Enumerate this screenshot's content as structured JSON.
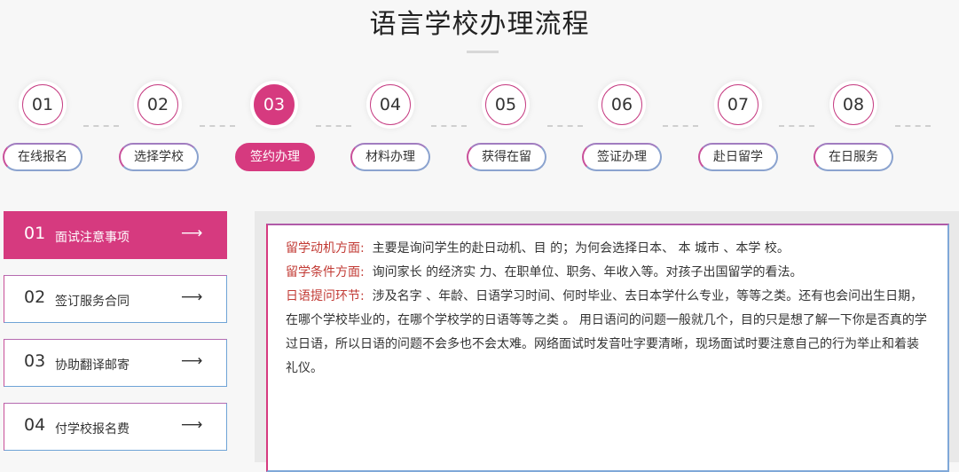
{
  "page": {
    "title": "语言学校办理流程"
  },
  "steps": [
    {
      "number": "01",
      "label": "在线报名",
      "active": false
    },
    {
      "number": "02",
      "label": "选择学校",
      "active": false
    },
    {
      "number": "03",
      "label": "签约办理",
      "active": true
    },
    {
      "number": "04",
      "label": "材料办理",
      "active": false
    },
    {
      "number": "05",
      "label": "获得在留",
      "active": false
    },
    {
      "number": "06",
      "label": "签证办理",
      "active": false
    },
    {
      "number": "07",
      "label": "赴日留学",
      "active": false
    },
    {
      "number": "08",
      "label": "在日服务",
      "active": false
    }
  ],
  "sidebar": {
    "items": [
      {
        "number": "01",
        "label": "面试注意事项",
        "arrow": "⟶",
        "active": true
      },
      {
        "number": "02",
        "label": "签订服务合同",
        "arrow": "⟶",
        "active": false
      },
      {
        "number": "03",
        "label": "协助翻译邮寄",
        "arrow": "⟶",
        "active": false
      },
      {
        "number": "04",
        "label": "付学校报名费",
        "arrow": "⟶",
        "active": false
      }
    ]
  },
  "content": {
    "paragraphs": [
      {
        "label": "留学动机方面:",
        "text": "主要是询问学生的赴日动机、目 的；为何会选择日本、 本 城市 、本学 校。"
      },
      {
        "label": "留学条件方面:",
        "text": "询问家长 的经济实 力、在职单位、职务、年收入等。对孩子出国留学的看法。"
      },
      {
        "label": "日语提问环节:",
        "text": "涉及名字 、年龄、日语学习时间、何时毕业、去日本学什么专业，等等之类。还有也会问出生日期，在哪个学校毕业的，在哪个学校学的日语等等之类 。 用日语问的问题一般就几个，目的只是想了解一下你是否真的学过日语，所以日语的问题不会多也不会太难。网络面试时发音吐字要清晰，现场面试时要注意自己的行为举止和着装礼仪。"
      }
    ]
  },
  "colors": {
    "accent": "#d63a7f",
    "label_red": "#c23b35",
    "border_blue": "#7fa8d8"
  }
}
